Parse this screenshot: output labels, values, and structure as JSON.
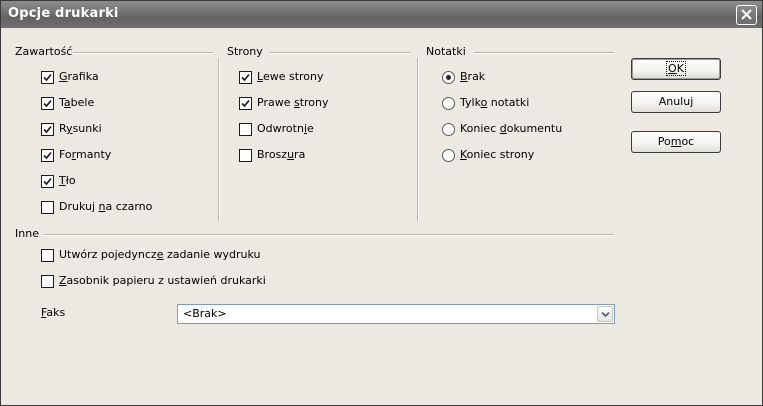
{
  "window": {
    "title": "Opcje drukarki"
  },
  "groups": {
    "contents": {
      "label": "Zawartość",
      "items": [
        {
          "pre": "",
          "key": "G",
          "post": "rafika",
          "checked": true
        },
        {
          "pre": "T",
          "key": "a",
          "post": "bele",
          "checked": true
        },
        {
          "pre": "R",
          "key": "y",
          "post": "sunki",
          "checked": true
        },
        {
          "pre": "Fo",
          "key": "r",
          "post": "manty",
          "checked": true
        },
        {
          "pre": "",
          "key": "T",
          "post": "ło",
          "checked": true
        },
        {
          "pre": "Drukuj ",
          "key": "n",
          "post": "a czarno",
          "checked": false
        }
      ]
    },
    "pages": {
      "label": "Strony",
      "items": [
        {
          "pre": "",
          "key": "L",
          "post": "ewe strony",
          "checked": true
        },
        {
          "pre": "Prawe ",
          "key": "s",
          "post": "trony",
          "checked": true
        },
        {
          "pre": "Odwrotn",
          "key": "i",
          "post": "e",
          "checked": false
        },
        {
          "pre": "Brosz",
          "key": "u",
          "post": "ra",
          "checked": false
        }
      ]
    },
    "notes": {
      "label": "Notatki",
      "items": [
        {
          "pre": "",
          "key": "B",
          "post": "rak",
          "selected": true
        },
        {
          "pre": "Tylk",
          "key": "o",
          "post": " notatki",
          "selected": false
        },
        {
          "pre": "Koniec ",
          "key": "d",
          "post": "okumentu",
          "selected": false
        },
        {
          "pre": "",
          "key": "K",
          "post": "oniec strony",
          "selected": false
        }
      ]
    },
    "other": {
      "label": "Inne",
      "items": [
        {
          "pre": "Utwórz pojedyncz",
          "key": "e",
          "post": " zadanie wydruku",
          "checked": false
        },
        {
          "pre": "",
          "key": "Z",
          "post": "asobnik papieru z ustawień drukarki",
          "checked": false
        }
      ],
      "fax": {
        "pre": "",
        "key": "F",
        "post": "aks",
        "value": "<Brak>"
      }
    }
  },
  "buttons": {
    "ok": {
      "pre": "",
      "key": "O",
      "post": "K"
    },
    "cancel": {
      "label": "Anuluj"
    },
    "help": {
      "pre": "Po",
      "key": "m",
      "post": "oc"
    }
  },
  "colors": {
    "titlebar": "#6f6f6f",
    "dialog_bg": "#ece9e2"
  },
  "icons": {
    "close": "close-icon",
    "dropdown": "chevron-down-icon",
    "check": "checkmark-icon"
  }
}
